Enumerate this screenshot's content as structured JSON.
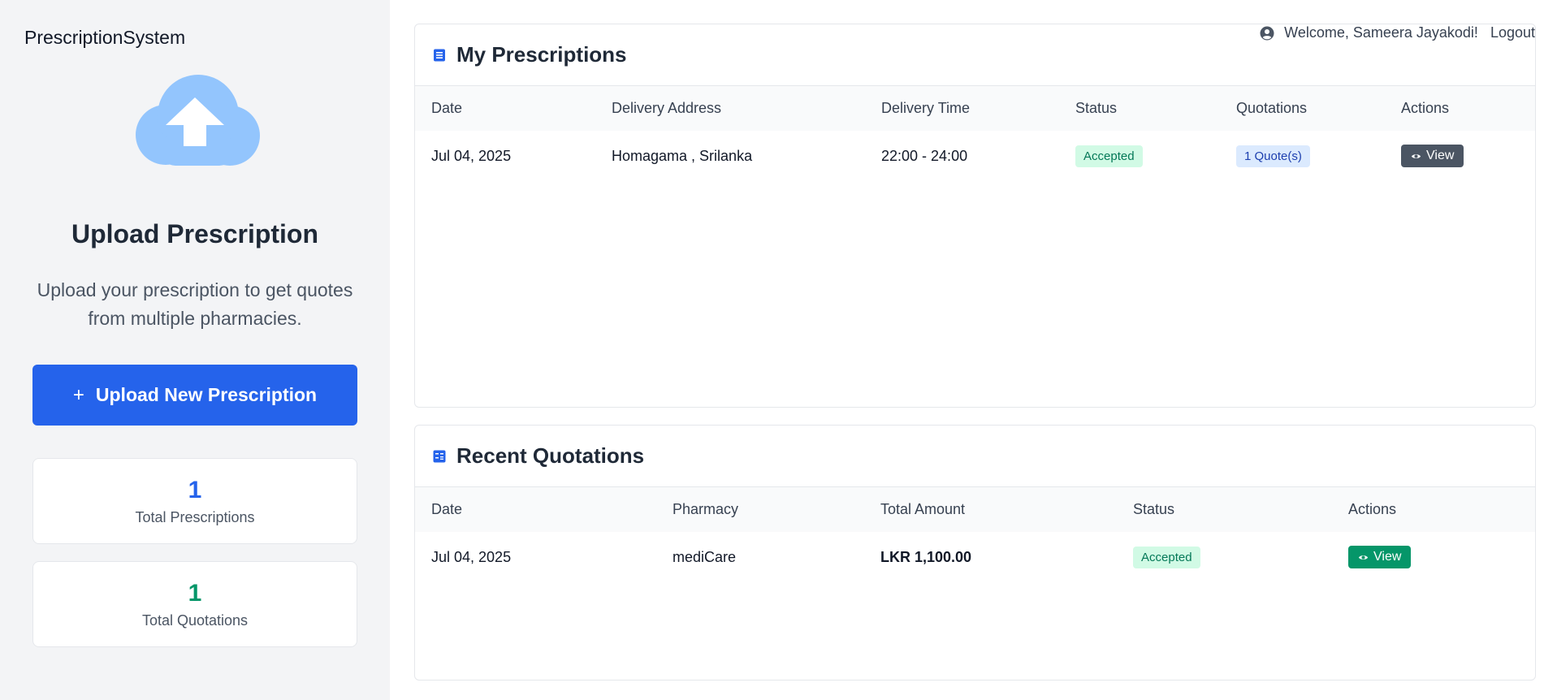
{
  "app": {
    "brand": "PrescriptionSystem"
  },
  "header": {
    "welcome": "Welcome, Sameera Jayakodi!",
    "logout": "Logout"
  },
  "sidebar": {
    "upload_title": "Upload Prescription",
    "upload_description": "Upload your prescription to get quotes from multiple pharmacies.",
    "upload_button_icon": "+",
    "upload_button": "Upload New Prescription",
    "stats": [
      {
        "value": "1",
        "label": "Total Prescriptions"
      },
      {
        "value": "1",
        "label": "Total Quotations"
      }
    ]
  },
  "prescriptions": {
    "title": "My Prescriptions",
    "columns": [
      "Date",
      "Delivery Address",
      "Delivery Time",
      "Status",
      "Quotations",
      "Actions"
    ],
    "rows": [
      {
        "date": "Jul 04, 2025",
        "address": "Homagama , Srilanka",
        "time": "22:00 - 24:00",
        "status": "Accepted",
        "quotations": "1 Quote(s)",
        "action": "View"
      }
    ]
  },
  "quotations": {
    "title": "Recent Quotations",
    "columns": [
      "Date",
      "Pharmacy",
      "Total Amount",
      "Status",
      "Actions"
    ],
    "rows": [
      {
        "date": "Jul 04, 2025",
        "pharmacy": "mediCare",
        "amount": "LKR 1,100.00",
        "status": "Accepted",
        "action": "View"
      }
    ]
  },
  "icons": {
    "cloud": "cloud-upload-icon",
    "user": "user-circle-icon",
    "prescriptions": "document-list-icon",
    "quotations": "calculator-icon",
    "view": "eye-icon"
  },
  "colors": {
    "primary": "#2563eb",
    "success": "#059669",
    "cloud": "#93c5fd",
    "dark_button": "#4b5563"
  }
}
